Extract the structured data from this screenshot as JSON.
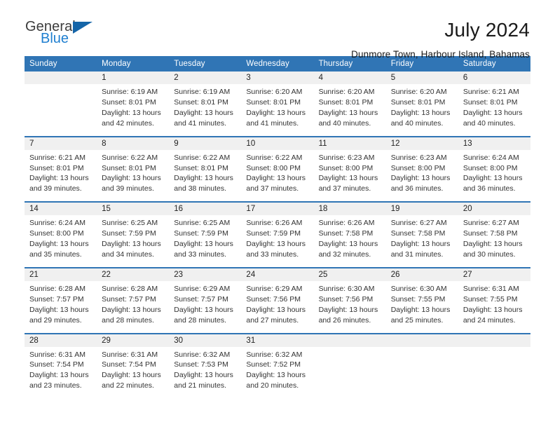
{
  "logo": {
    "part1": "General",
    "part2": "Blue",
    "triangle_color": "#1565a8",
    "blue_text_color": "#1f7fd0"
  },
  "header": {
    "title": "July 2024",
    "subtitle": "Dunmore Town, Harbour Island, Bahamas"
  },
  "theme": {
    "header_blue": "#3075b5",
    "daynum_band": "#f0f0f0"
  },
  "calendar": {
    "weekday_headers": [
      "Sunday",
      "Monday",
      "Tuesday",
      "Wednesday",
      "Thursday",
      "Friday",
      "Saturday"
    ],
    "weeks": [
      [
        {
          "day": "",
          "empty": true,
          "sunrise": "",
          "sunset": "",
          "daylight1": "",
          "daylight2": ""
        },
        {
          "day": "1",
          "sunrise": "Sunrise: 6:19 AM",
          "sunset": "Sunset: 8:01 PM",
          "daylight1": "Daylight: 13 hours",
          "daylight2": "and 42 minutes."
        },
        {
          "day": "2",
          "sunrise": "Sunrise: 6:19 AM",
          "sunset": "Sunset: 8:01 PM",
          "daylight1": "Daylight: 13 hours",
          "daylight2": "and 41 minutes."
        },
        {
          "day": "3",
          "sunrise": "Sunrise: 6:20 AM",
          "sunset": "Sunset: 8:01 PM",
          "daylight1": "Daylight: 13 hours",
          "daylight2": "and 41 minutes."
        },
        {
          "day": "4",
          "sunrise": "Sunrise: 6:20 AM",
          "sunset": "Sunset: 8:01 PM",
          "daylight1": "Daylight: 13 hours",
          "daylight2": "and 40 minutes."
        },
        {
          "day": "5",
          "sunrise": "Sunrise: 6:20 AM",
          "sunset": "Sunset: 8:01 PM",
          "daylight1": "Daylight: 13 hours",
          "daylight2": "and 40 minutes."
        },
        {
          "day": "6",
          "sunrise": "Sunrise: 6:21 AM",
          "sunset": "Sunset: 8:01 PM",
          "daylight1": "Daylight: 13 hours",
          "daylight2": "and 40 minutes."
        }
      ],
      [
        {
          "day": "7",
          "sunrise": "Sunrise: 6:21 AM",
          "sunset": "Sunset: 8:01 PM",
          "daylight1": "Daylight: 13 hours",
          "daylight2": "and 39 minutes."
        },
        {
          "day": "8",
          "sunrise": "Sunrise: 6:22 AM",
          "sunset": "Sunset: 8:01 PM",
          "daylight1": "Daylight: 13 hours",
          "daylight2": "and 39 minutes."
        },
        {
          "day": "9",
          "sunrise": "Sunrise: 6:22 AM",
          "sunset": "Sunset: 8:01 PM",
          "daylight1": "Daylight: 13 hours",
          "daylight2": "and 38 minutes."
        },
        {
          "day": "10",
          "sunrise": "Sunrise: 6:22 AM",
          "sunset": "Sunset: 8:00 PM",
          "daylight1": "Daylight: 13 hours",
          "daylight2": "and 37 minutes."
        },
        {
          "day": "11",
          "sunrise": "Sunrise: 6:23 AM",
          "sunset": "Sunset: 8:00 PM",
          "daylight1": "Daylight: 13 hours",
          "daylight2": "and 37 minutes."
        },
        {
          "day": "12",
          "sunrise": "Sunrise: 6:23 AM",
          "sunset": "Sunset: 8:00 PM",
          "daylight1": "Daylight: 13 hours",
          "daylight2": "and 36 minutes."
        },
        {
          "day": "13",
          "sunrise": "Sunrise: 6:24 AM",
          "sunset": "Sunset: 8:00 PM",
          "daylight1": "Daylight: 13 hours",
          "daylight2": "and 36 minutes."
        }
      ],
      [
        {
          "day": "14",
          "sunrise": "Sunrise: 6:24 AM",
          "sunset": "Sunset: 8:00 PM",
          "daylight1": "Daylight: 13 hours",
          "daylight2": "and 35 minutes."
        },
        {
          "day": "15",
          "sunrise": "Sunrise: 6:25 AM",
          "sunset": "Sunset: 7:59 PM",
          "daylight1": "Daylight: 13 hours",
          "daylight2": "and 34 minutes."
        },
        {
          "day": "16",
          "sunrise": "Sunrise: 6:25 AM",
          "sunset": "Sunset: 7:59 PM",
          "daylight1": "Daylight: 13 hours",
          "daylight2": "and 33 minutes."
        },
        {
          "day": "17",
          "sunrise": "Sunrise: 6:26 AM",
          "sunset": "Sunset: 7:59 PM",
          "daylight1": "Daylight: 13 hours",
          "daylight2": "and 33 minutes."
        },
        {
          "day": "18",
          "sunrise": "Sunrise: 6:26 AM",
          "sunset": "Sunset: 7:58 PM",
          "daylight1": "Daylight: 13 hours",
          "daylight2": "and 32 minutes."
        },
        {
          "day": "19",
          "sunrise": "Sunrise: 6:27 AM",
          "sunset": "Sunset: 7:58 PM",
          "daylight1": "Daylight: 13 hours",
          "daylight2": "and 31 minutes."
        },
        {
          "day": "20",
          "sunrise": "Sunrise: 6:27 AM",
          "sunset": "Sunset: 7:58 PM",
          "daylight1": "Daylight: 13 hours",
          "daylight2": "and 30 minutes."
        }
      ],
      [
        {
          "day": "21",
          "sunrise": "Sunrise: 6:28 AM",
          "sunset": "Sunset: 7:57 PM",
          "daylight1": "Daylight: 13 hours",
          "daylight2": "and 29 minutes."
        },
        {
          "day": "22",
          "sunrise": "Sunrise: 6:28 AM",
          "sunset": "Sunset: 7:57 PM",
          "daylight1": "Daylight: 13 hours",
          "daylight2": "and 28 minutes."
        },
        {
          "day": "23",
          "sunrise": "Sunrise: 6:29 AM",
          "sunset": "Sunset: 7:57 PM",
          "daylight1": "Daylight: 13 hours",
          "daylight2": "and 28 minutes."
        },
        {
          "day": "24",
          "sunrise": "Sunrise: 6:29 AM",
          "sunset": "Sunset: 7:56 PM",
          "daylight1": "Daylight: 13 hours",
          "daylight2": "and 27 minutes."
        },
        {
          "day": "25",
          "sunrise": "Sunrise: 6:30 AM",
          "sunset": "Sunset: 7:56 PM",
          "daylight1": "Daylight: 13 hours",
          "daylight2": "and 26 minutes."
        },
        {
          "day": "26",
          "sunrise": "Sunrise: 6:30 AM",
          "sunset": "Sunset: 7:55 PM",
          "daylight1": "Daylight: 13 hours",
          "daylight2": "and 25 minutes."
        },
        {
          "day": "27",
          "sunrise": "Sunrise: 6:31 AM",
          "sunset": "Sunset: 7:55 PM",
          "daylight1": "Daylight: 13 hours",
          "daylight2": "and 24 minutes."
        }
      ],
      [
        {
          "day": "28",
          "sunrise": "Sunrise: 6:31 AM",
          "sunset": "Sunset: 7:54 PM",
          "daylight1": "Daylight: 13 hours",
          "daylight2": "and 23 minutes."
        },
        {
          "day": "29",
          "sunrise": "Sunrise: 6:31 AM",
          "sunset": "Sunset: 7:54 PM",
          "daylight1": "Daylight: 13 hours",
          "daylight2": "and 22 minutes."
        },
        {
          "day": "30",
          "sunrise": "Sunrise: 6:32 AM",
          "sunset": "Sunset: 7:53 PM",
          "daylight1": "Daylight: 13 hours",
          "daylight2": "and 21 minutes."
        },
        {
          "day": "31",
          "sunrise": "Sunrise: 6:32 AM",
          "sunset": "Sunset: 7:52 PM",
          "daylight1": "Daylight: 13 hours",
          "daylight2": "and 20 minutes."
        },
        {
          "day": "",
          "empty": true,
          "sunrise": "",
          "sunset": "",
          "daylight1": "",
          "daylight2": ""
        },
        {
          "day": "",
          "empty": true,
          "sunrise": "",
          "sunset": "",
          "daylight1": "",
          "daylight2": ""
        },
        {
          "day": "",
          "empty": true,
          "sunrise": "",
          "sunset": "",
          "daylight1": "",
          "daylight2": ""
        }
      ]
    ]
  }
}
